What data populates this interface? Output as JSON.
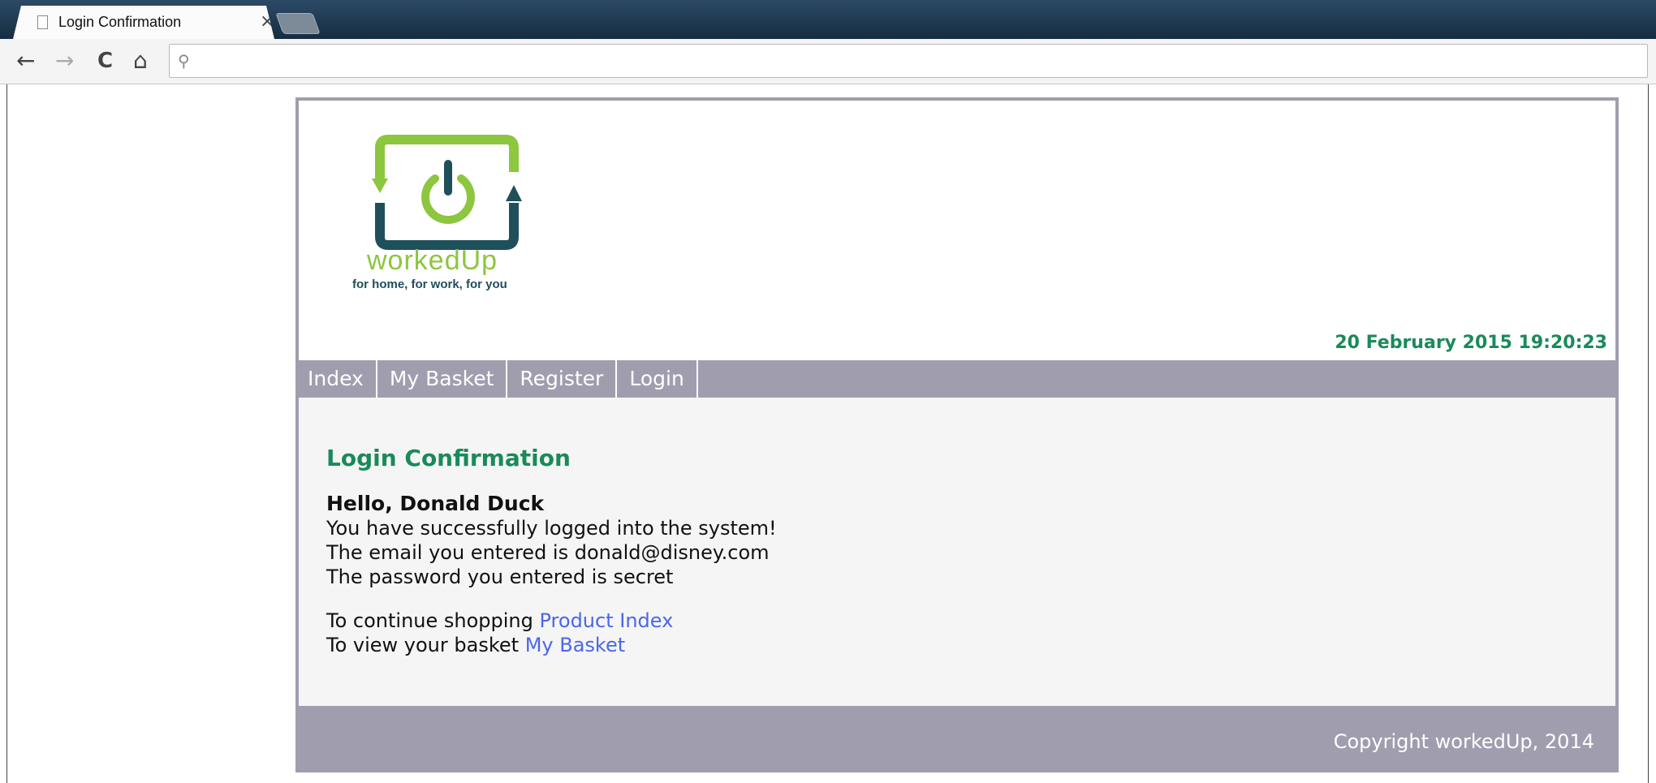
{
  "browser": {
    "tab_title": "Login Confirmation",
    "tab_close": "×",
    "back": "←",
    "forward": "→",
    "reload": "C",
    "home": "⌂",
    "search_glyph": "⚲"
  },
  "site": {
    "logo_word": "workedUp",
    "logo_tagline": "for home, for work, for you",
    "datetime": "20 February 2015 19:20:23",
    "nav": [
      "Index",
      "My Basket",
      "Register",
      "Login"
    ],
    "content": {
      "heading": "Login Confirmation",
      "greeting": "Hello, Donald Duck",
      "line1": "You have successfully logged into the system!",
      "line2": "The email you entered is donald@disney.com",
      "line3": "The password you entered is secret",
      "continue_text": "To continue shopping ",
      "continue_link": "Product Index",
      "basket_text": "To view your basket ",
      "basket_link": "My Basket"
    },
    "footer": "Copyright workedUp, 2014"
  },
  "colors": {
    "brand_green": "#8dc63f",
    "brand_dark": "#1f4f5a",
    "heading_green": "#1a8a5a",
    "nav_gray": "#a09eae",
    "link_blue": "#4a67e6"
  }
}
